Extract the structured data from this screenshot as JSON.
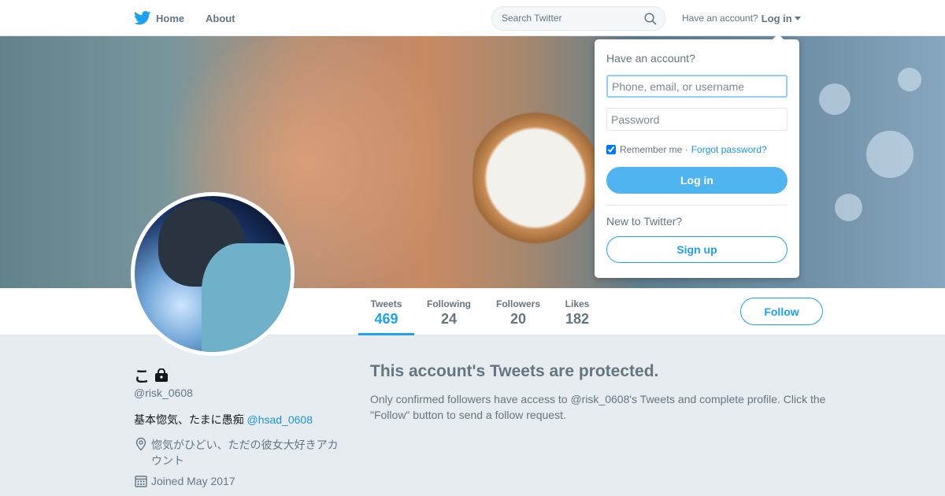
{
  "nav": {
    "home_label": "Home",
    "about_label": "About",
    "search_placeholder": "Search Twitter",
    "have_account": "Have an account?",
    "login_label": "Log in"
  },
  "profile": {
    "name": "こ",
    "handle": "@risk_0608",
    "bio_text": "基本惚気、たまに愚痴 ",
    "bio_mention": "@hsad_0608",
    "location": "惚気がひどい、ただの彼女大好きアカウント",
    "joined": "Joined May 2017"
  },
  "stats": [
    {
      "label": "Tweets",
      "value": "469"
    },
    {
      "label": "Following",
      "value": "24"
    },
    {
      "label": "Followers",
      "value": "20"
    },
    {
      "label": "Likes",
      "value": "182"
    }
  ],
  "follow_label": "Follow",
  "protected": {
    "title": "This account's Tweets are protected.",
    "body": "Only confirmed followers have access to @risk_0608's Tweets and complete profile. Click the \"Follow\" button to send a follow request."
  },
  "login_dropdown": {
    "title": "Have an account?",
    "username_placeholder": "Phone, email, or username",
    "password_placeholder": "Password",
    "remember_label": "Remember me ·",
    "forgot_label": "Forgot password?",
    "login_button": "Log in",
    "new_label": "New to Twitter?",
    "signup_button": "Sign up"
  },
  "colors": {
    "accent": "#1da1f2",
    "page_bg": "#e6ecf0",
    "muted_text": "#66757f"
  }
}
